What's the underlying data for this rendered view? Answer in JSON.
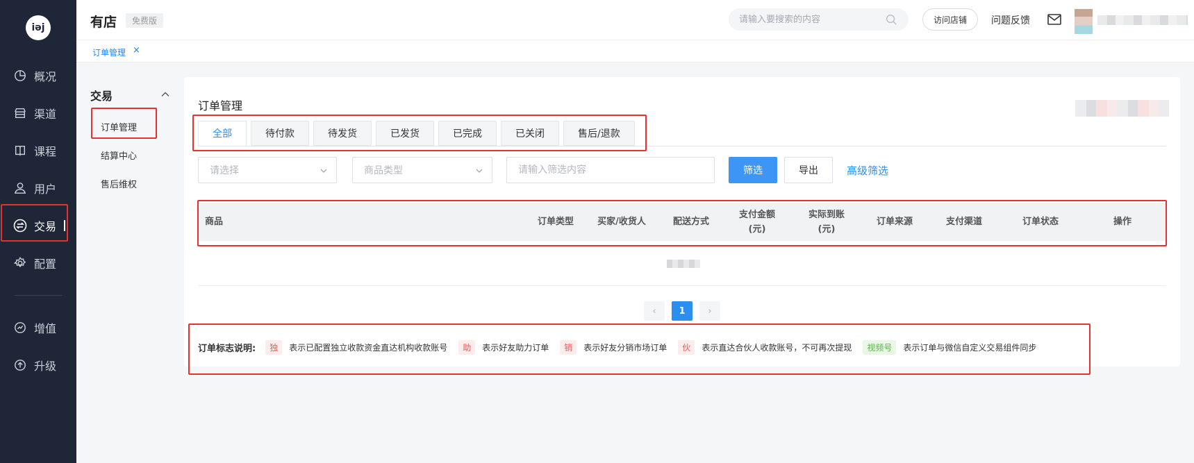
{
  "sidebar": {
    "logo_text": "iǝj",
    "items": [
      {
        "label": "概况",
        "icon": "pie-chart-icon"
      },
      {
        "label": "渠道",
        "icon": "store-icon"
      },
      {
        "label": "课程",
        "icon": "book-icon"
      },
      {
        "label": "用户",
        "icon": "user-icon"
      },
      {
        "label": "交易",
        "icon": "exchange-icon"
      },
      {
        "label": "配置",
        "icon": "gear-icon"
      },
      {
        "label": "增值",
        "icon": "value-added-icon"
      },
      {
        "label": "升级",
        "icon": "upgrade-icon"
      }
    ],
    "active_index": 4
  },
  "header": {
    "shop_name": "有店",
    "edition": "免费版",
    "search_placeholder": "请输入要搜索的内容",
    "visit_store": "访问店铺",
    "feedback": "问题反馈"
  },
  "tabbar": {
    "page_tab": "订单管理",
    "close": "×"
  },
  "submenu": {
    "title": "交易",
    "items": [
      "订单管理",
      "结算中心",
      "售后维权"
    ]
  },
  "main": {
    "title": "订单管理",
    "status_tabs": [
      "全部",
      "待付款",
      "待发货",
      "已发货",
      "已完成",
      "已关闭",
      "售后/退款"
    ],
    "filters": {
      "select1_placeholder": "请选择",
      "select2_placeholder": "商品类型",
      "input_placeholder": "请输入筛选内容",
      "filter_button": "筛选",
      "export_button": "导出",
      "advanced_link": "高级筛选"
    },
    "table": {
      "columns": [
        {
          "label": "商品"
        },
        {
          "label": "订单类型"
        },
        {
          "label": "买家/收货人"
        },
        {
          "label": "配送方式"
        },
        {
          "label": "支付金额\n(元)"
        },
        {
          "label": "实际到账\n(元)"
        },
        {
          "label": "订单来源"
        },
        {
          "label": "支付渠道"
        },
        {
          "label": "订单状态"
        },
        {
          "label": "操作"
        }
      ]
    },
    "pagination": {
      "prev": "‹",
      "current": "1",
      "next": "›"
    },
    "legend": {
      "title": "订单标志说明:",
      "items": [
        {
          "badge": "独",
          "text": "表示已配置独立收款资金直达机构收款账号",
          "color": "red"
        },
        {
          "badge": "助",
          "text": "表示好友助力订单",
          "color": "red"
        },
        {
          "badge": "销",
          "text": "表示好友分销市场订单",
          "color": "red"
        },
        {
          "badge": "伙",
          "text": "表示直达合伙人收款账号，不可再次提现",
          "color": "red"
        },
        {
          "badge": "视频号",
          "text": "表示订单与微信自定义交易组件同步",
          "color": "green"
        }
      ]
    }
  },
  "colors": {
    "sidebar_bg": "#1f2638",
    "primary": "#2b8ff0",
    "annotation_red": "#e8312f"
  }
}
